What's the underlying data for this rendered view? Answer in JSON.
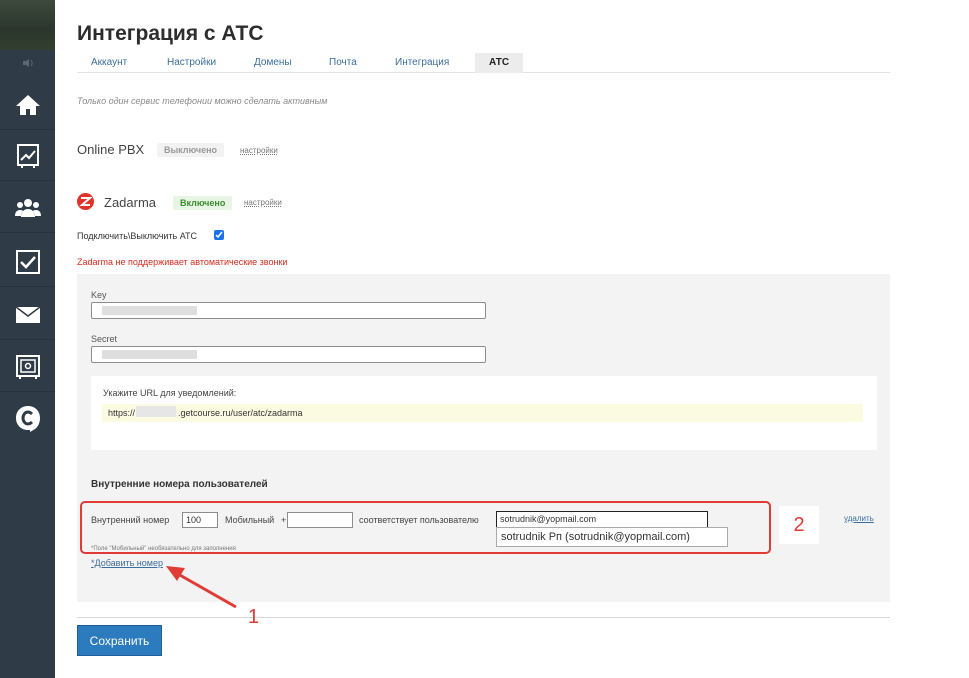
{
  "page": {
    "title": "Интеграция с АТС"
  },
  "tabs": [
    {
      "label": "Аккаунт"
    },
    {
      "label": "Настройки"
    },
    {
      "label": "Домены"
    },
    {
      "label": "Почта"
    },
    {
      "label": "Интеграция"
    },
    {
      "label": "АТС",
      "active": true
    }
  ],
  "note": "Только один сервис телефонии можно сделать активным",
  "services": [
    {
      "name": "Online PBX",
      "status": "Выключено",
      "settings_label": "настройки"
    },
    {
      "name": "Zadarma",
      "status": "Включено",
      "settings_label": "настройки"
    }
  ],
  "toggle": {
    "label": "Подключить\\Выключить АТС",
    "checked": true
  },
  "warning": "Zadarma не поддерживает автоматические звонки",
  "fields": {
    "key_label": "Key",
    "secret_label": "Secret"
  },
  "url_block": {
    "title": "Укажите URL для уведомлений:",
    "prefix": "https://",
    "suffix": ".getcourse.ru/user/atc/zadarma"
  },
  "internal": {
    "title": "Внутренние номера пользователей",
    "ext_label": "Внутренний номер",
    "ext_value": "100",
    "mobile_label": "Мобильный",
    "mobile_prefix": "+",
    "mobile_value": "",
    "user_label": "соответствует пользователю",
    "user_value": "sotrudnik@yopmail.com",
    "suggestion": "sotrudnik Рп (sotrudnik@yopmail.com)",
    "note": "*Поле \"Мобильный\" необязательно для заполнения",
    "add_label": "*Добавить номер",
    "delete_label": "удалить"
  },
  "annotations": {
    "marker1": "1",
    "marker2": "2"
  },
  "save_label": "Сохранить",
  "colors": {
    "sidebar": "#2f3b47",
    "accent": "#2d7bbf",
    "link": "#3b6e9c",
    "annotation": "#e03b34",
    "enabled": "#3a8d2e",
    "warning": "#d62b1f"
  }
}
